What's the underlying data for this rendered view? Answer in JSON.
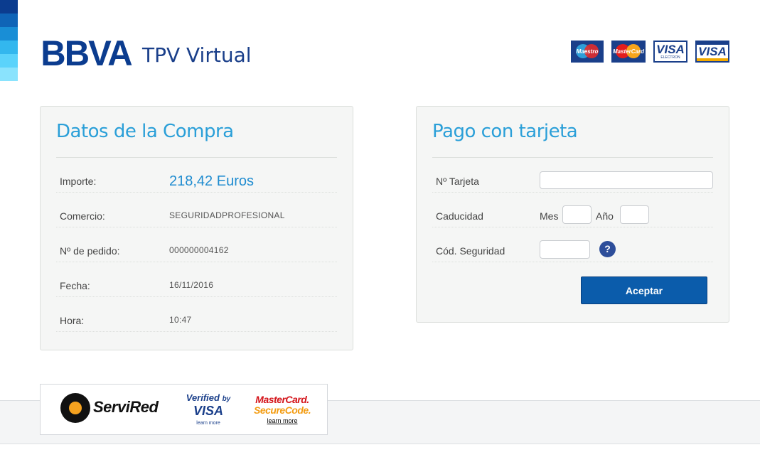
{
  "colors": {
    "stripe": [
      "#0b3c8f",
      "#0f64b7",
      "#198ed6",
      "#33b7ee",
      "#5bd3fb",
      "#8ae3fd"
    ],
    "title_blue": "#2a9fd8",
    "button_blue": "#0b5cab",
    "brand_navy": "#0b3c8f"
  },
  "header": {
    "brand": "BBVA",
    "product": "TPV Virtual",
    "card_logos": [
      {
        "name": "maestro-logo",
        "text": "Maestro"
      },
      {
        "name": "mastercard-logo",
        "text": "MasterCard"
      },
      {
        "name": "visa-electron-logo",
        "text": "VISA",
        "sub": "ELECTRON"
      },
      {
        "name": "visa-logo",
        "text": "VISA"
      }
    ]
  },
  "purchase": {
    "title": "Datos de la Compra",
    "rows": [
      {
        "label": "Importe:",
        "value": "218,42 Euros"
      },
      {
        "label": "Comercio:",
        "value": "SEGURIDADPROFESIONAL"
      },
      {
        "label": "Nº de pedido:",
        "value": "000000004162"
      },
      {
        "label": "Fecha:",
        "value": "16/11/2016"
      },
      {
        "label": "Hora:",
        "value": "10:47"
      }
    ]
  },
  "payment": {
    "title": "Pago con tarjeta",
    "card_number_label": "Nº Tarjeta",
    "card_number_value": "",
    "expiry_label": "Caducidad",
    "month_label": "Mes",
    "month_value": "",
    "year_label": "Año",
    "year_value": "",
    "security_label": "Cód. Seguridad",
    "security_value": "",
    "help_glyph": "?",
    "submit_label": "Aceptar"
  },
  "footer": {
    "servired": "ServiRed",
    "verified_top": "Verified",
    "verified_by": "by",
    "verified_visa": "VISA",
    "verified_learn": "learn more",
    "mastercard_line1": "MasterCard.",
    "mastercard_line2": "SecureCode.",
    "mastercard_learn": "learn more"
  }
}
